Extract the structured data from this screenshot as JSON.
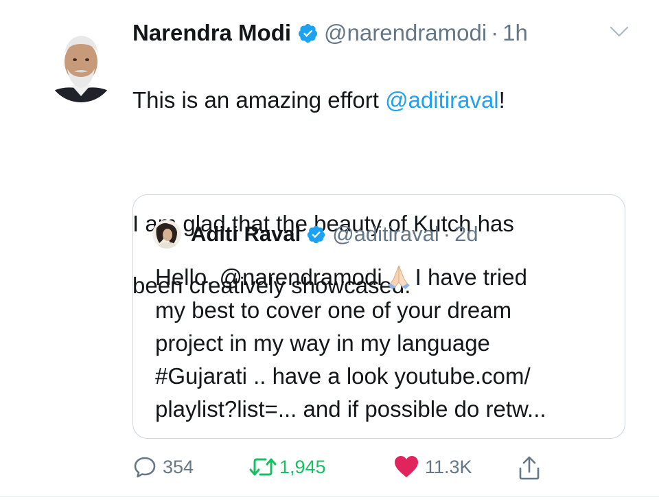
{
  "tweet": {
    "author_name": "Narendra Modi",
    "author_handle": "@narendramodi",
    "separator": "·",
    "time": "1h",
    "text_part1": "This is an amazing effort ",
    "text_mention": "@aditiraval",
    "text_part2": "!",
    "text_para2_line1": "I am glad that the beauty of Kutch has",
    "text_para2_line2": "been creatively showcased."
  },
  "quoted_tweet": {
    "author_name": "Aditi Raval",
    "author_handle": "@aditiraval",
    "separator": "·",
    "time": "2d",
    "line1_a": "Hello, @narendramodi",
    "line1_b": "I have tried",
    "line2": "my best to cover one of your dream",
    "line3": "project in my way in my language",
    "line4": "#Gujarati .. have a look youtube.com/",
    "line5": "playlist?list=... and if possible do retw..."
  },
  "actions": {
    "reply_count": "354",
    "retweet_count": "1,945",
    "like_count": "11.3K"
  },
  "icons": {
    "verified": "verified-badge-icon",
    "caret": "chevron-down-icon",
    "reply": "comment-icon",
    "retweet": "retweet-icon",
    "like": "heart-icon",
    "share": "share-icon",
    "folded_hands": "folded-hands-emoji"
  },
  "colors": {
    "link": "#1da1f2",
    "verified": "#1da1f2",
    "retweet": "#17bf63",
    "like": "#e0245e",
    "muted": "#657786"
  }
}
